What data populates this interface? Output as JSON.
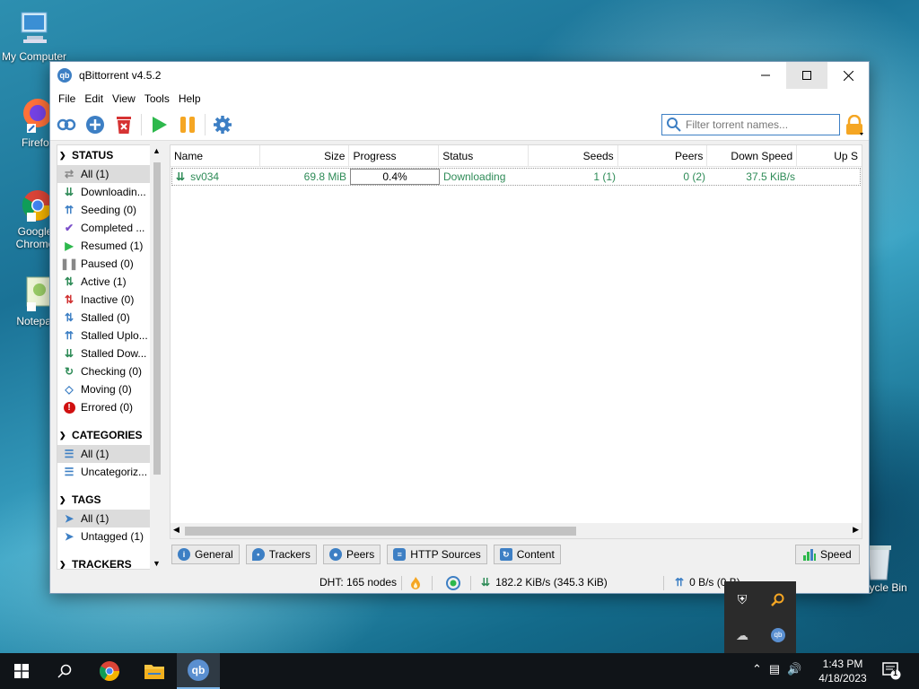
{
  "desktop": {
    "icons": [
      {
        "label": "My Computer"
      },
      {
        "label": "Firefox"
      },
      {
        "label": "Google Chrome"
      },
      {
        "label": "Notepad"
      }
    ],
    "recycle_bin": "Recycle Bin"
  },
  "window": {
    "title": "qBittorrent v4.5.2",
    "app_icon_text": "qb",
    "menu": [
      "File",
      "Edit",
      "View",
      "Tools",
      "Help"
    ],
    "search_placeholder": "Filter torrent names..."
  },
  "sidebar": {
    "status_header": "STATUS",
    "status_items": [
      {
        "label": "All (1)",
        "icon": "shuffle-icon",
        "color": "#888888"
      },
      {
        "label": "Downloadin...",
        "icon": "download-icon",
        "color": "#2e8b57"
      },
      {
        "label": "Seeding (0)",
        "icon": "upload-icon",
        "color": "#3d7fc4"
      },
      {
        "label": "Completed ...",
        "icon": "check-icon",
        "color": "#7b4fc9"
      },
      {
        "label": "Resumed (1)",
        "icon": "play-icon",
        "color": "#2db84c"
      },
      {
        "label": "Paused (0)",
        "icon": "pause-icon",
        "color": "#888888"
      },
      {
        "label": "Active (1)",
        "icon": "updown-icon",
        "color": "#2e8b57"
      },
      {
        "label": "Inactive (0)",
        "icon": "updown-red-icon",
        "color": "#d03030"
      },
      {
        "label": "Stalled (0)",
        "icon": "updown-blue-icon",
        "color": "#3d7fc4"
      },
      {
        "label": "Stalled Uplo...",
        "icon": "stalled-upload-icon",
        "color": "#3d7fc4"
      },
      {
        "label": "Stalled Dow...",
        "icon": "stalled-download-icon",
        "color": "#2e8b57"
      },
      {
        "label": "Checking (0)",
        "icon": "refresh-icon",
        "color": "#2e8b57"
      },
      {
        "label": "Moving (0)",
        "icon": "moving-icon",
        "color": "#3d7fc4"
      },
      {
        "label": "Errored (0)",
        "icon": "error-icon",
        "color": "#d01010"
      }
    ],
    "categories_header": "CATEGORIES",
    "category_items": [
      {
        "label": "All (1)"
      },
      {
        "label": "Uncategoriz..."
      }
    ],
    "tags_header": "TAGS",
    "tag_items": [
      {
        "label": "All (1)"
      },
      {
        "label": "Untagged (1)"
      }
    ],
    "trackers_header": "TRACKERS"
  },
  "transfer_list": {
    "columns": [
      "Name",
      "Size",
      "Progress",
      "Status",
      "Seeds",
      "Peers",
      "Down Speed",
      "Up S"
    ],
    "rows": [
      {
        "name": "sv034",
        "size": "69.8 MiB",
        "progress": "0.4%",
        "status": "Downloading",
        "seeds": "1 (1)",
        "peers": "0 (2)",
        "down_speed": "37.5 KiB/s",
        "up_speed": ""
      }
    ]
  },
  "tabs": [
    "General",
    "Trackers",
    "Peers",
    "HTTP Sources",
    "Content"
  ],
  "speed_tab": "Speed",
  "statusbar": {
    "dht": "DHT: 165 nodes",
    "down": "182.2 KiB/s (345.3 KiB)",
    "up": "0 B/s (0 B)"
  },
  "taskbar": {
    "time": "1:43 PM",
    "date": "4/18/2023",
    "notification_count": "1"
  },
  "colors": {
    "accent": "#3d7fc4",
    "downloading": "#2e8b57"
  }
}
